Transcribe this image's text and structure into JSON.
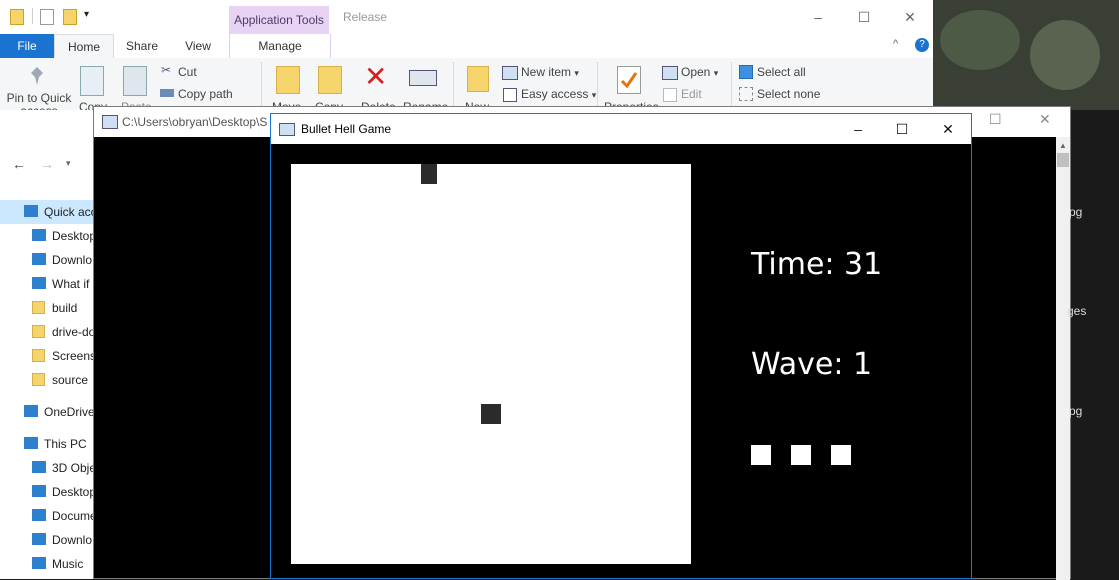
{
  "explorer": {
    "context_tab": "Application Tools",
    "release_label": "Release",
    "tabs": [
      "File",
      "Home",
      "Share",
      "View",
      "Manage"
    ],
    "ribbon": {
      "pin_label": "Pin to Quick access",
      "copy_label": "Copy",
      "paste_label": "Paste",
      "cut_label": "Cut",
      "copy_path_label": "Copy path",
      "move_label": "Move",
      "copy2_label": "Copy",
      "delete_label": "Delete",
      "rename_label": "Rename",
      "new_label": "New",
      "new_item_label": "New item",
      "easy_access_label": "Easy access",
      "properties_label": "Properties",
      "open_label": "Open",
      "edit_label": "Edit",
      "select_all_label": "Select all",
      "select_none_label": "Select none"
    },
    "nav_items": [
      {
        "label": "Quick acc",
        "icon": "star-icon"
      },
      {
        "label": "Desktop",
        "icon": "desktop-icon"
      },
      {
        "label": "Downlo",
        "icon": "download-icon"
      },
      {
        "label": "What if",
        "icon": "tree-icon"
      },
      {
        "label": "build",
        "icon": "folder-icon"
      },
      {
        "label": "drive-do",
        "icon": "folder-icon"
      },
      {
        "label": "Screens",
        "icon": "folder-icon"
      },
      {
        "label": "source",
        "icon": "folder-icon"
      },
      {
        "label": "OneDrive",
        "icon": "cloud-icon"
      },
      {
        "label": "This PC",
        "icon": "pc-icon"
      },
      {
        "label": "3D Obje",
        "icon": "cube-icon"
      },
      {
        "label": "Desktop",
        "icon": "desktop-icon"
      },
      {
        "label": "Docume",
        "icon": "document-icon"
      },
      {
        "label": "Downlo",
        "icon": "download-icon"
      },
      {
        "label": "Music",
        "icon": "music-icon"
      }
    ]
  },
  "back_window": {
    "title": "C:\\Users\\obryan\\Desktop\\S",
    "side_labels": [
      "pg",
      "ges",
      "pg"
    ]
  },
  "game": {
    "title": "Bullet Hell Game",
    "time_label": "Time: 31",
    "wave_label": "Wave: 1",
    "lives": 3
  }
}
